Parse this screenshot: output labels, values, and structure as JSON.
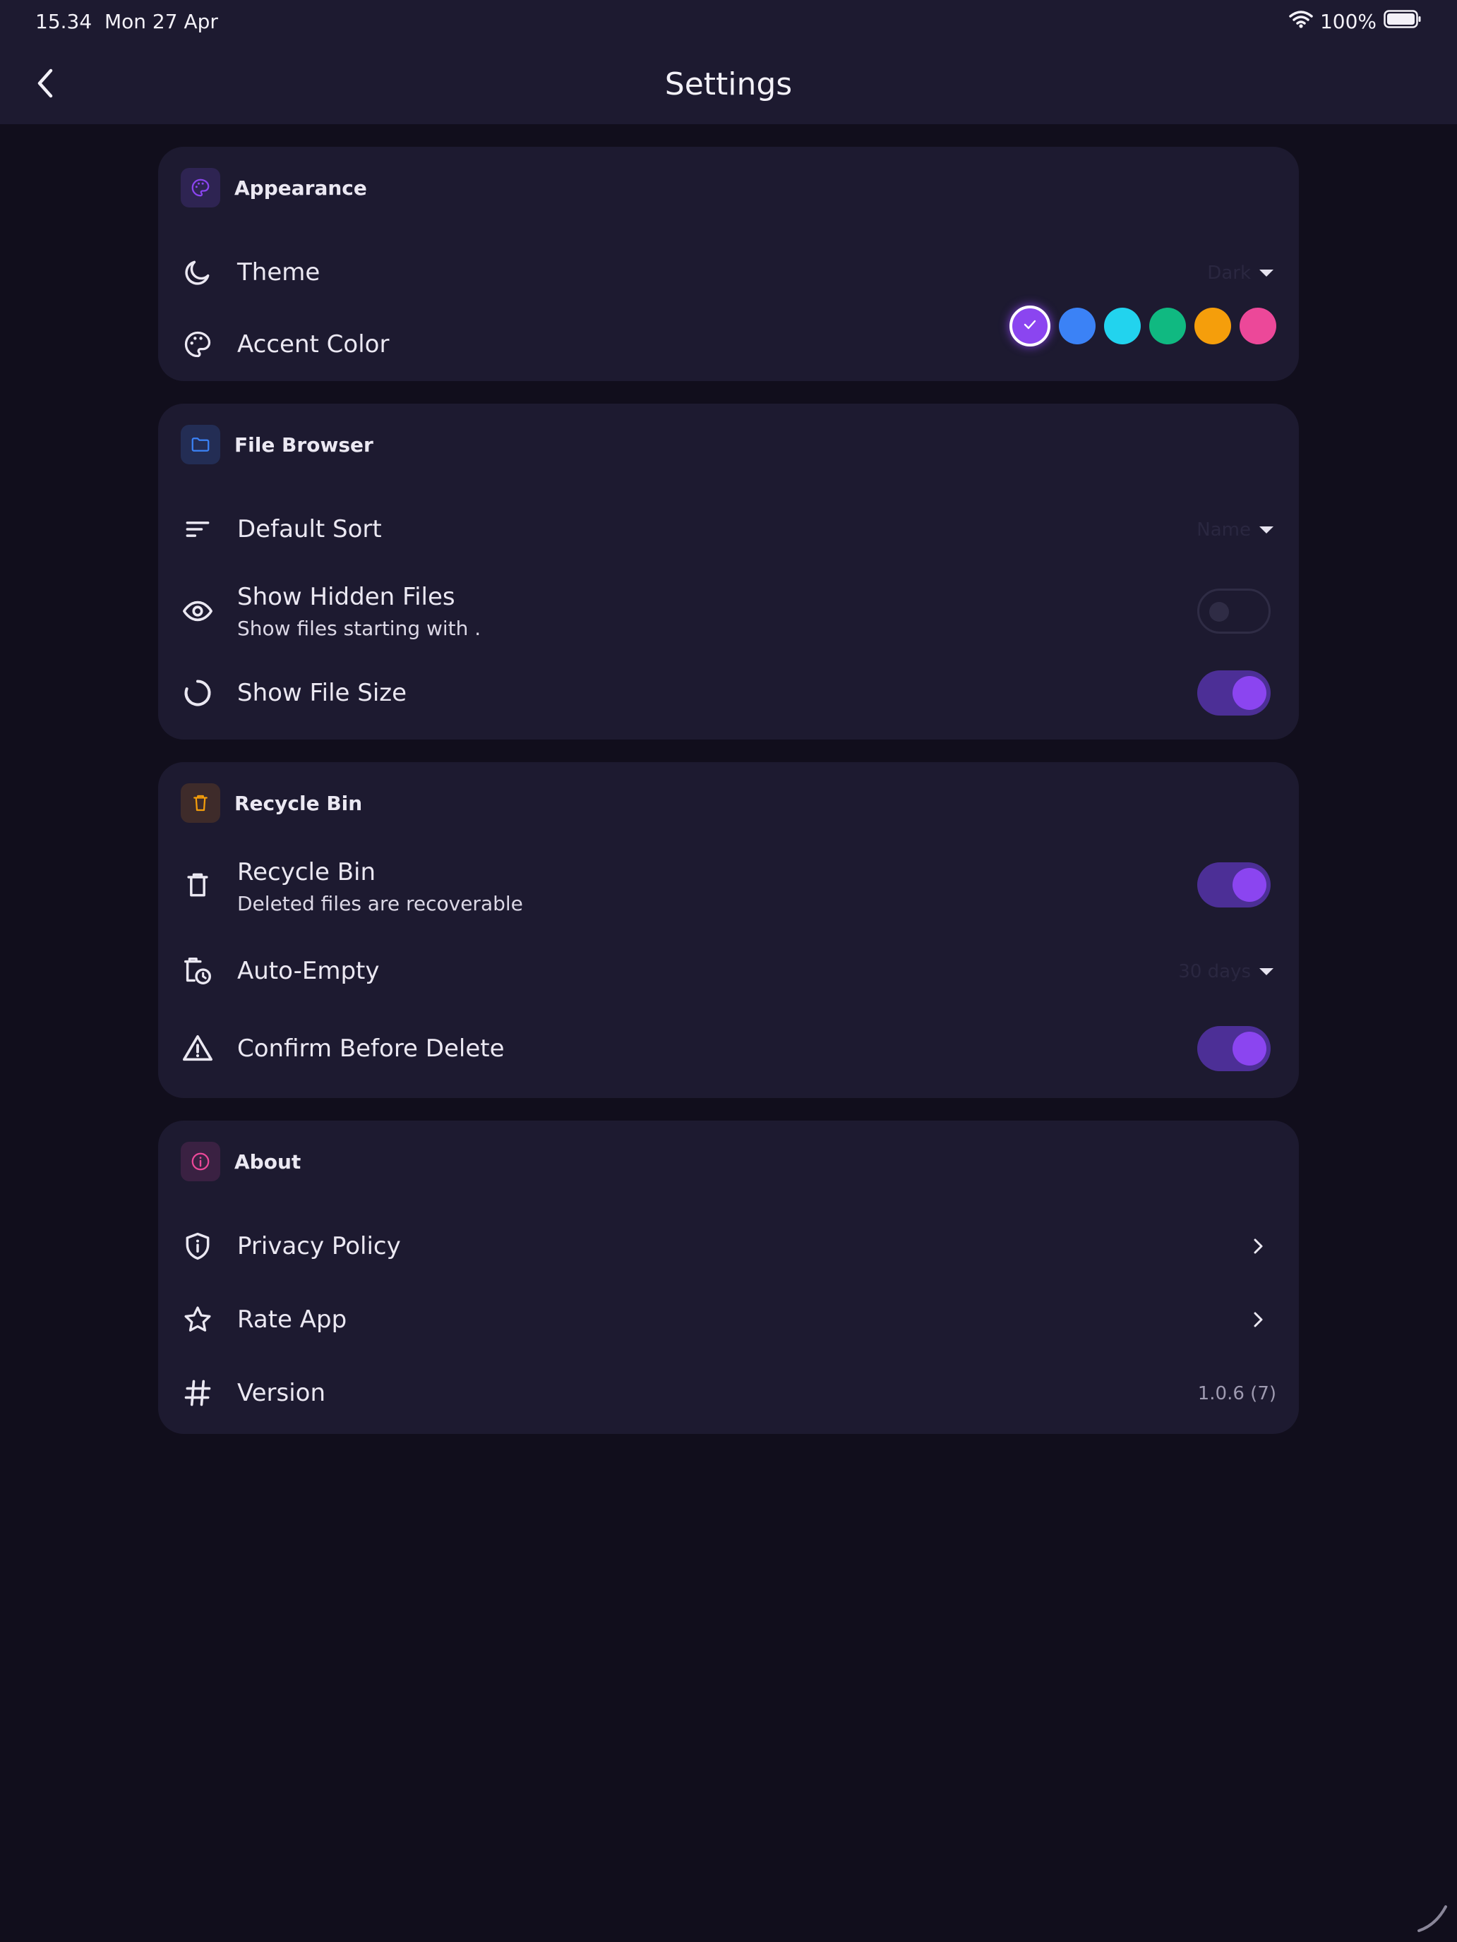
{
  "status_bar": {
    "time": "15.34",
    "date": "Mon 27 Apr",
    "battery": "100%"
  },
  "header": {
    "title": "Settings",
    "back_icon": "chevron-left-icon"
  },
  "colors": {
    "accent": "#8b45f0",
    "blue": "#3b82f6",
    "cyan": "#22d3ee",
    "green": "#10b981",
    "orange": "#f59e0b",
    "pink": "#ec4899"
  },
  "appearance": {
    "title": "Appearance",
    "icon": "palette-icon",
    "theme": {
      "label": "Theme",
      "icon": "moon-icon",
      "value": "Dark"
    },
    "accent": {
      "label": "Accent Color",
      "icon": "palette-icon",
      "selected": "purple",
      "options": [
        "purple",
        "blue",
        "cyan",
        "green",
        "orange",
        "pink"
      ]
    }
  },
  "file_browser": {
    "title": "File Browser",
    "icon": "folder-icon",
    "default_sort": {
      "label": "Default Sort",
      "icon": "sort-icon",
      "value": "Name"
    },
    "hidden_files": {
      "label": "Show Hidden Files",
      "sub": "Show files starting with .",
      "icon": "eye-icon",
      "enabled": false
    },
    "file_size": {
      "label": "Show File Size",
      "icon": "pie-chart-icon",
      "enabled": true
    }
  },
  "recycle_bin": {
    "title": "Recycle Bin",
    "icon": "trash-icon",
    "bin": {
      "label": "Recycle Bin",
      "sub": "Deleted files are recoverable",
      "icon": "trash-icon",
      "enabled": true
    },
    "auto_empty": {
      "label": "Auto-Empty",
      "icon": "trash-clock-icon",
      "value": "30 days"
    },
    "confirm": {
      "label": "Confirm Before Delete",
      "icon": "warning-icon",
      "enabled": true
    }
  },
  "about": {
    "title": "About",
    "icon": "info-icon",
    "privacy": {
      "label": "Privacy Policy",
      "icon": "shield-icon"
    },
    "rate": {
      "label": "Rate App",
      "icon": "star-icon"
    },
    "version": {
      "label": "Version",
      "icon": "hash-icon",
      "value": "1.0.6 (7)"
    }
  }
}
